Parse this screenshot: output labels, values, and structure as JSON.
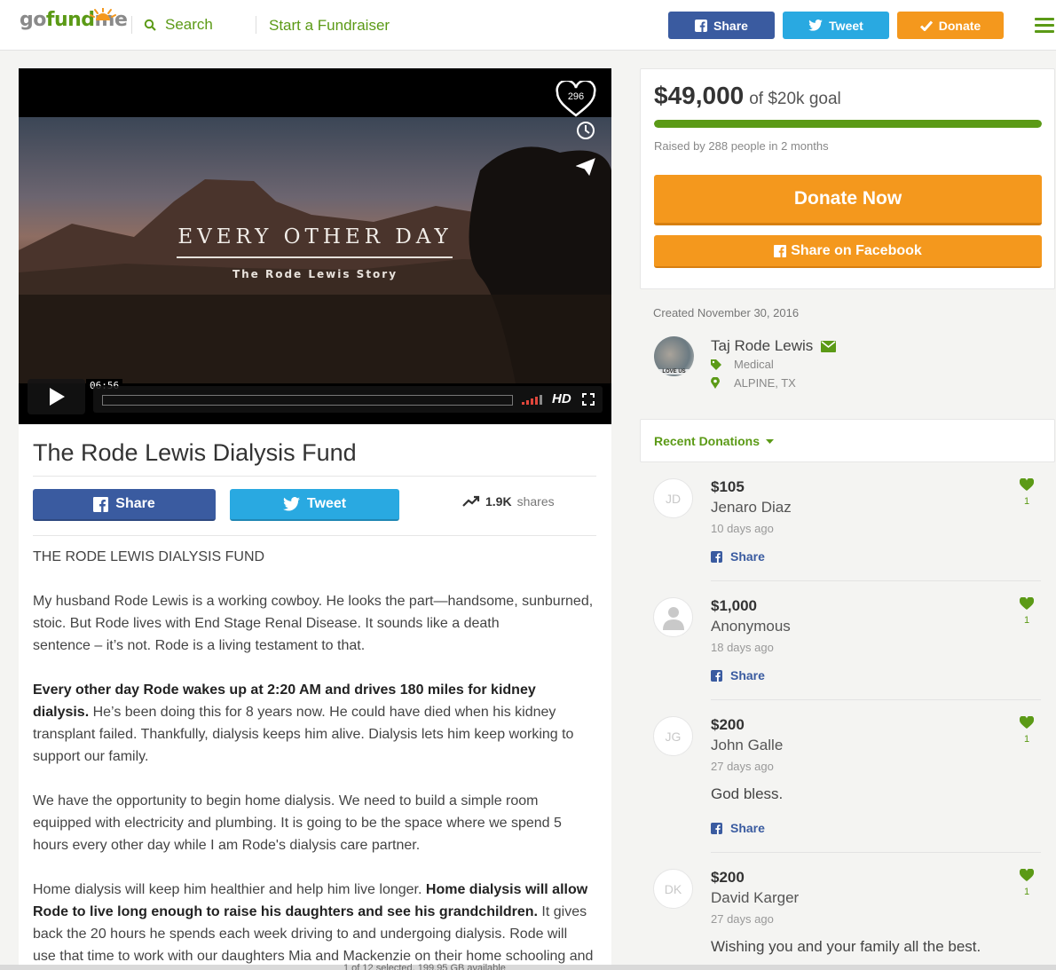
{
  "header": {
    "logo": {
      "go": "go",
      "fund": "fund",
      "me": "me"
    },
    "search_label": "Search",
    "start_fundraiser": "Start a Fundraiser",
    "share_label": "Share",
    "tweet_label": "Tweet",
    "donate_label": "Donate",
    "colors": {
      "brand_green": "#5b9a16",
      "facebook_blue": "#3a5ba0",
      "twitter_blue": "#29a9e1",
      "donate_orange": "#f4981d"
    }
  },
  "video": {
    "title": "EVERY OTHER DAY",
    "subtitle": "The Rode Lewis Story",
    "heart_count": "296",
    "duration": "06:56",
    "hd_label": "HD",
    "icons": [
      "heart-icon",
      "clock-icon",
      "paper-plane-icon",
      "play-icon",
      "volume-icon",
      "fullscreen-icon"
    ]
  },
  "campaign": {
    "title": "The Rode Lewis Dialysis Fund",
    "share_label": "Share",
    "tweet_label": "Tweet",
    "shares_count": "1.9K",
    "shares_label": "shares",
    "story": {
      "p1": "THE RODE LEWIS DIALYSIS FUND",
      "p2_line1": "My husband Rode Lewis is a working cowboy. He looks the part—handsome, sunburned, stoic. But Rode lives with End Stage Renal Disease. It sounds like a death",
      "p2_line2": "sentence – it’s not. Rode is a living testament to that.",
      "p3_bold": "Every other day Rode wakes up at 2:20 AM and drives 180 miles for kidney dialysis.",
      "p3_rest": " He’s been doing this for 8 years now. He could have died when his kidney transplant failed. Thankfully, dialysis keeps him alive. Dialysis lets him keep working to support our family.",
      "p4": "We have the opportunity to begin home dialysis. We need to build a simple room equipped with electricity and plumbing. It is going to be the space where we spend 5 hours every other day while I am Rode's dialysis care partner.",
      "p5_start": "Home dialysis will keep him healthier and help him live longer. ",
      "p5_bold": "Home dialysis will allow Rode to live long enough to raise his daughters and see his grandchildren.",
      "p5_rest": " It gives back the 20 hours he spends each week driving to and undergoing dialysis. Rode will use that time to work with our daughters Mia and Mackenzie on their home schooling and"
    },
    "bottom_strip_text": "1 of 12 selected, 199.95 GB available"
  },
  "goal": {
    "raised_amount": "$49,000",
    "goal_text": "of $20k goal",
    "progress_fraction": 1.0,
    "raised_by": "Raised by 288 people in 2 months",
    "donate_now_label": "Donate Now",
    "share_facebook_label": "Share on Facebook"
  },
  "organizer": {
    "created": "Created November 30, 2016",
    "name": "Taj Rode Lewis",
    "avatar_caption": "LOVE US",
    "category": "Medical",
    "location": "ALPINE, TX"
  },
  "recent": {
    "header": "Recent Donations",
    "donations": [
      {
        "initials": "JD",
        "amount": "$105",
        "name": "Jenaro Diaz",
        "time": "10 days ago",
        "message": "",
        "likes": "1",
        "share_label": "Share"
      },
      {
        "initials": "",
        "amount": "$1,000",
        "name": "Anonymous",
        "time": "18 days ago",
        "message": "",
        "likes": "1",
        "share_label": "Share"
      },
      {
        "initials": "JG",
        "amount": "$200",
        "name": "John Galle",
        "time": "27 days ago",
        "message": "God bless.",
        "likes": "1",
        "share_label": "Share"
      },
      {
        "initials": "DK",
        "amount": "$200",
        "name": "David Karger",
        "time": "27 days ago",
        "message": "Wishing you and your family all the best.",
        "likes": "1",
        "share_label": "Share"
      }
    ]
  }
}
